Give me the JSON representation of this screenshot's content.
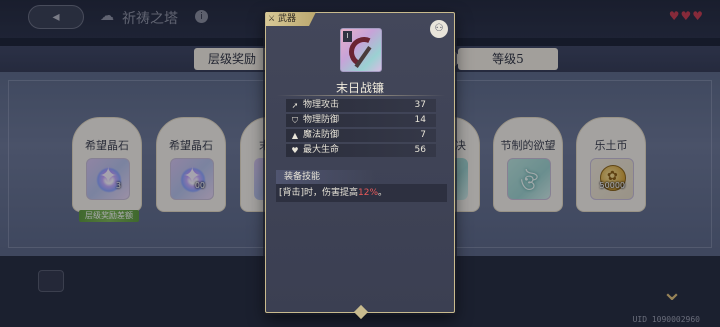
{
  "header": {
    "back_icon": "back-arrow-icon",
    "title": "祈祷之塔",
    "info_label": "i",
    "hearts": "♥♥♥"
  },
  "tiers": {
    "left_label": "层级奖励",
    "right_label": "等级5"
  },
  "cards": [
    {
      "title": "希望晶石",
      "icon": "star-gem-icon",
      "qty": "3"
    },
    {
      "title": "希望晶石",
      "icon": "star-gem-icon",
      "qty": "00"
    },
    {
      "title": "节制的欲望",
      "icon": "relic-icon",
      "qty": ""
    },
    {
      "title": "乐土币",
      "icon": "coin-icon",
      "qty": "50000"
    }
  ],
  "partial_cards": {
    "left_title": "末",
    "right_title": "决"
  },
  "bonus_tag": "层级奖励差额",
  "popup": {
    "category": "武器",
    "rank": "I",
    "item_name": "末日战镰",
    "stats": [
      {
        "icon": "sword-stat-icon",
        "name": "物理攻击",
        "value": "37"
      },
      {
        "icon": "shield-stat-icon",
        "name": "物理防御",
        "value": "14"
      },
      {
        "icon": "hat-stat-icon",
        "name": "魔法防御",
        "value": "7"
      },
      {
        "icon": "heart-stat-icon",
        "name": "最大生命",
        "value": "56"
      }
    ],
    "skill_header": "装备技能",
    "skill_text_pre": "[背击]时，伤害提高",
    "skill_text_value": "12%",
    "skill_text_post": "。"
  },
  "footer": {
    "uid": "UID 1090002960"
  },
  "colors": {
    "accent_gold": "#c9bb8e",
    "bonus_green": "#6ca847",
    "highlight_red": "#e85a5a"
  }
}
